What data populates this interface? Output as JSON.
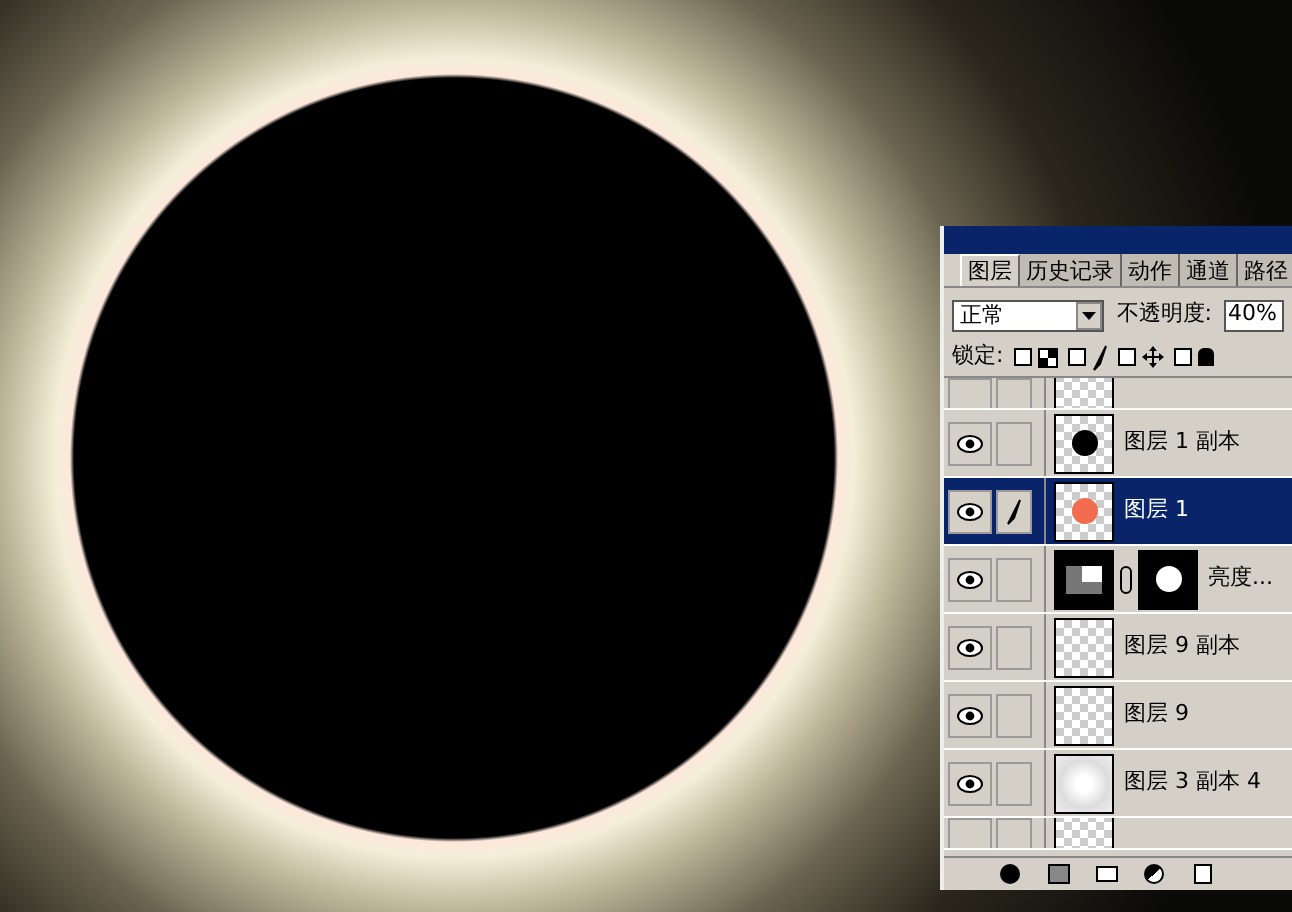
{
  "panel": {
    "tabs": [
      {
        "label": "图层",
        "selected": true
      },
      {
        "label": "历史记录",
        "selected": false
      },
      {
        "label": "动作",
        "selected": false
      },
      {
        "label": "通道",
        "selected": false
      },
      {
        "label": "路径",
        "selected": false
      }
    ],
    "blend_mode": "正常",
    "opacity_label": "不透明度:",
    "opacity": "40%",
    "lock_label": "锁定:",
    "locks": [
      {
        "kind": "transparency",
        "checked": false
      },
      {
        "kind": "brush",
        "checked": false
      },
      {
        "kind": "move",
        "checked": false
      },
      {
        "kind": "lock",
        "checked": false
      }
    ],
    "layers": [
      {
        "kind": "blank",
        "visible": false,
        "brush": false,
        "selected": false,
        "partial": true
      },
      {
        "name": "图层 1 副本",
        "kind": "dot",
        "color": "#000000",
        "visible": true,
        "brush": false,
        "selected": false,
        "partial": false
      },
      {
        "name": "图层 1",
        "kind": "dot",
        "color": "#f26c4f",
        "visible": true,
        "brush": true,
        "selected": true,
        "partial": false
      },
      {
        "name": "亮度...",
        "kind": "adjustment",
        "visible": true,
        "brush": false,
        "selected": false,
        "partial": false
      },
      {
        "name": "图层 9 副本",
        "kind": "blank",
        "visible": true,
        "brush": false,
        "selected": false,
        "partial": false
      },
      {
        "name": "图层 9",
        "kind": "blank",
        "visible": true,
        "brush": false,
        "selected": false,
        "partial": false
      },
      {
        "name": "图层 3 副本 4",
        "kind": "glow",
        "visible": true,
        "brush": false,
        "selected": false,
        "partial": false
      },
      {
        "kind": "blank",
        "visible": false,
        "brush": false,
        "selected": false,
        "partial": true
      }
    ]
  }
}
